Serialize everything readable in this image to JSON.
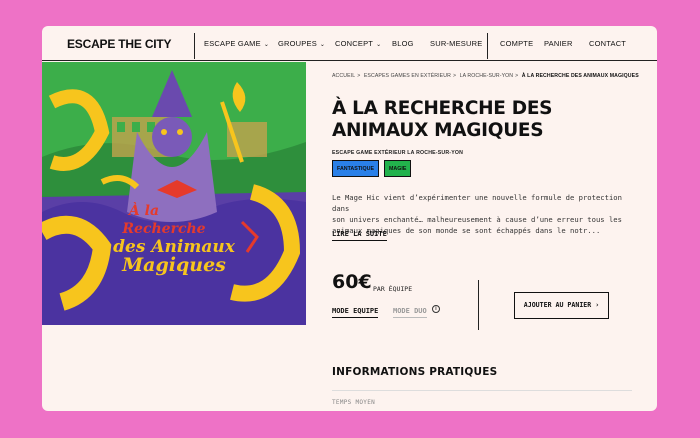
{
  "brand": {
    "logo_text": "ESCAPE THE CITY"
  },
  "nav": {
    "items": [
      {
        "label": "ESCAPE GAME",
        "has_dropdown": true
      },
      {
        "label": "GROUPES",
        "has_dropdown": true
      },
      {
        "label": "CONCEPT",
        "has_dropdown": true
      },
      {
        "label": "BLOG",
        "has_dropdown": false
      },
      {
        "label": "SUR-MESURE",
        "has_dropdown": false
      }
    ],
    "right_items": [
      {
        "label": "COMPTE"
      },
      {
        "label": "PANIER"
      },
      {
        "label": "CONTACT"
      }
    ],
    "chevron": "⌄"
  },
  "hero": {
    "poster_title_line1": "À la",
    "poster_title_line2": "Recherche",
    "poster_title_line3": "des Animaux",
    "poster_title_line4": "Magiques"
  },
  "breadcrumb": {
    "items": [
      "ACCUEIL",
      "ESCAPES GAMES EN EXTÉRIEUR",
      "LA ROCHE-SUR-YON"
    ],
    "current": "À LA RECHERCHE DES ANIMAUX MAGIQUES",
    "separator": ">"
  },
  "product": {
    "title_line1": "À LA RECHERCHE DES",
    "title_line2": "ANIMAUX MAGIQUES",
    "subtitle": "ESCAPE GAME EXTÉRIEUR LA ROCHE-SUR-YON",
    "tags": [
      {
        "label": "FANTASTIQUE",
        "color": "#2a80e8"
      },
      {
        "label": "MAGIE",
        "color": "#22b24c"
      }
    ],
    "description_lines": [
      "Le Mage Hic vient d’expérimenter une nouvelle formule de protection dans",
      "son univers enchanté… malheureusement à cause d’une erreur tous les",
      "animaux magiques de son monde se sont échappés dans le notr..."
    ],
    "read_more": "LIRE LA SUITE",
    "price": "60€",
    "price_unit": "PAR ÉQUIPE",
    "modes": {
      "active": "MODE EQUIPE",
      "inactive": "MODE DUO"
    },
    "info_icon": "info-icon",
    "add_to_cart": "AJOUTER AU PANIER",
    "add_to_cart_chevron": "›"
  },
  "practical_info": {
    "title": "INFORMATIONS PRATIQUES",
    "first_label": "TEMPS MOYEN"
  },
  "colors": {
    "background": "#ee72c6",
    "page": "#fdf3ef",
    "poster_purple": "#5a3fa6",
    "poster_green": "#3cae4a",
    "poster_yellow": "#f7c51d",
    "poster_red": "#e53a2b"
  }
}
